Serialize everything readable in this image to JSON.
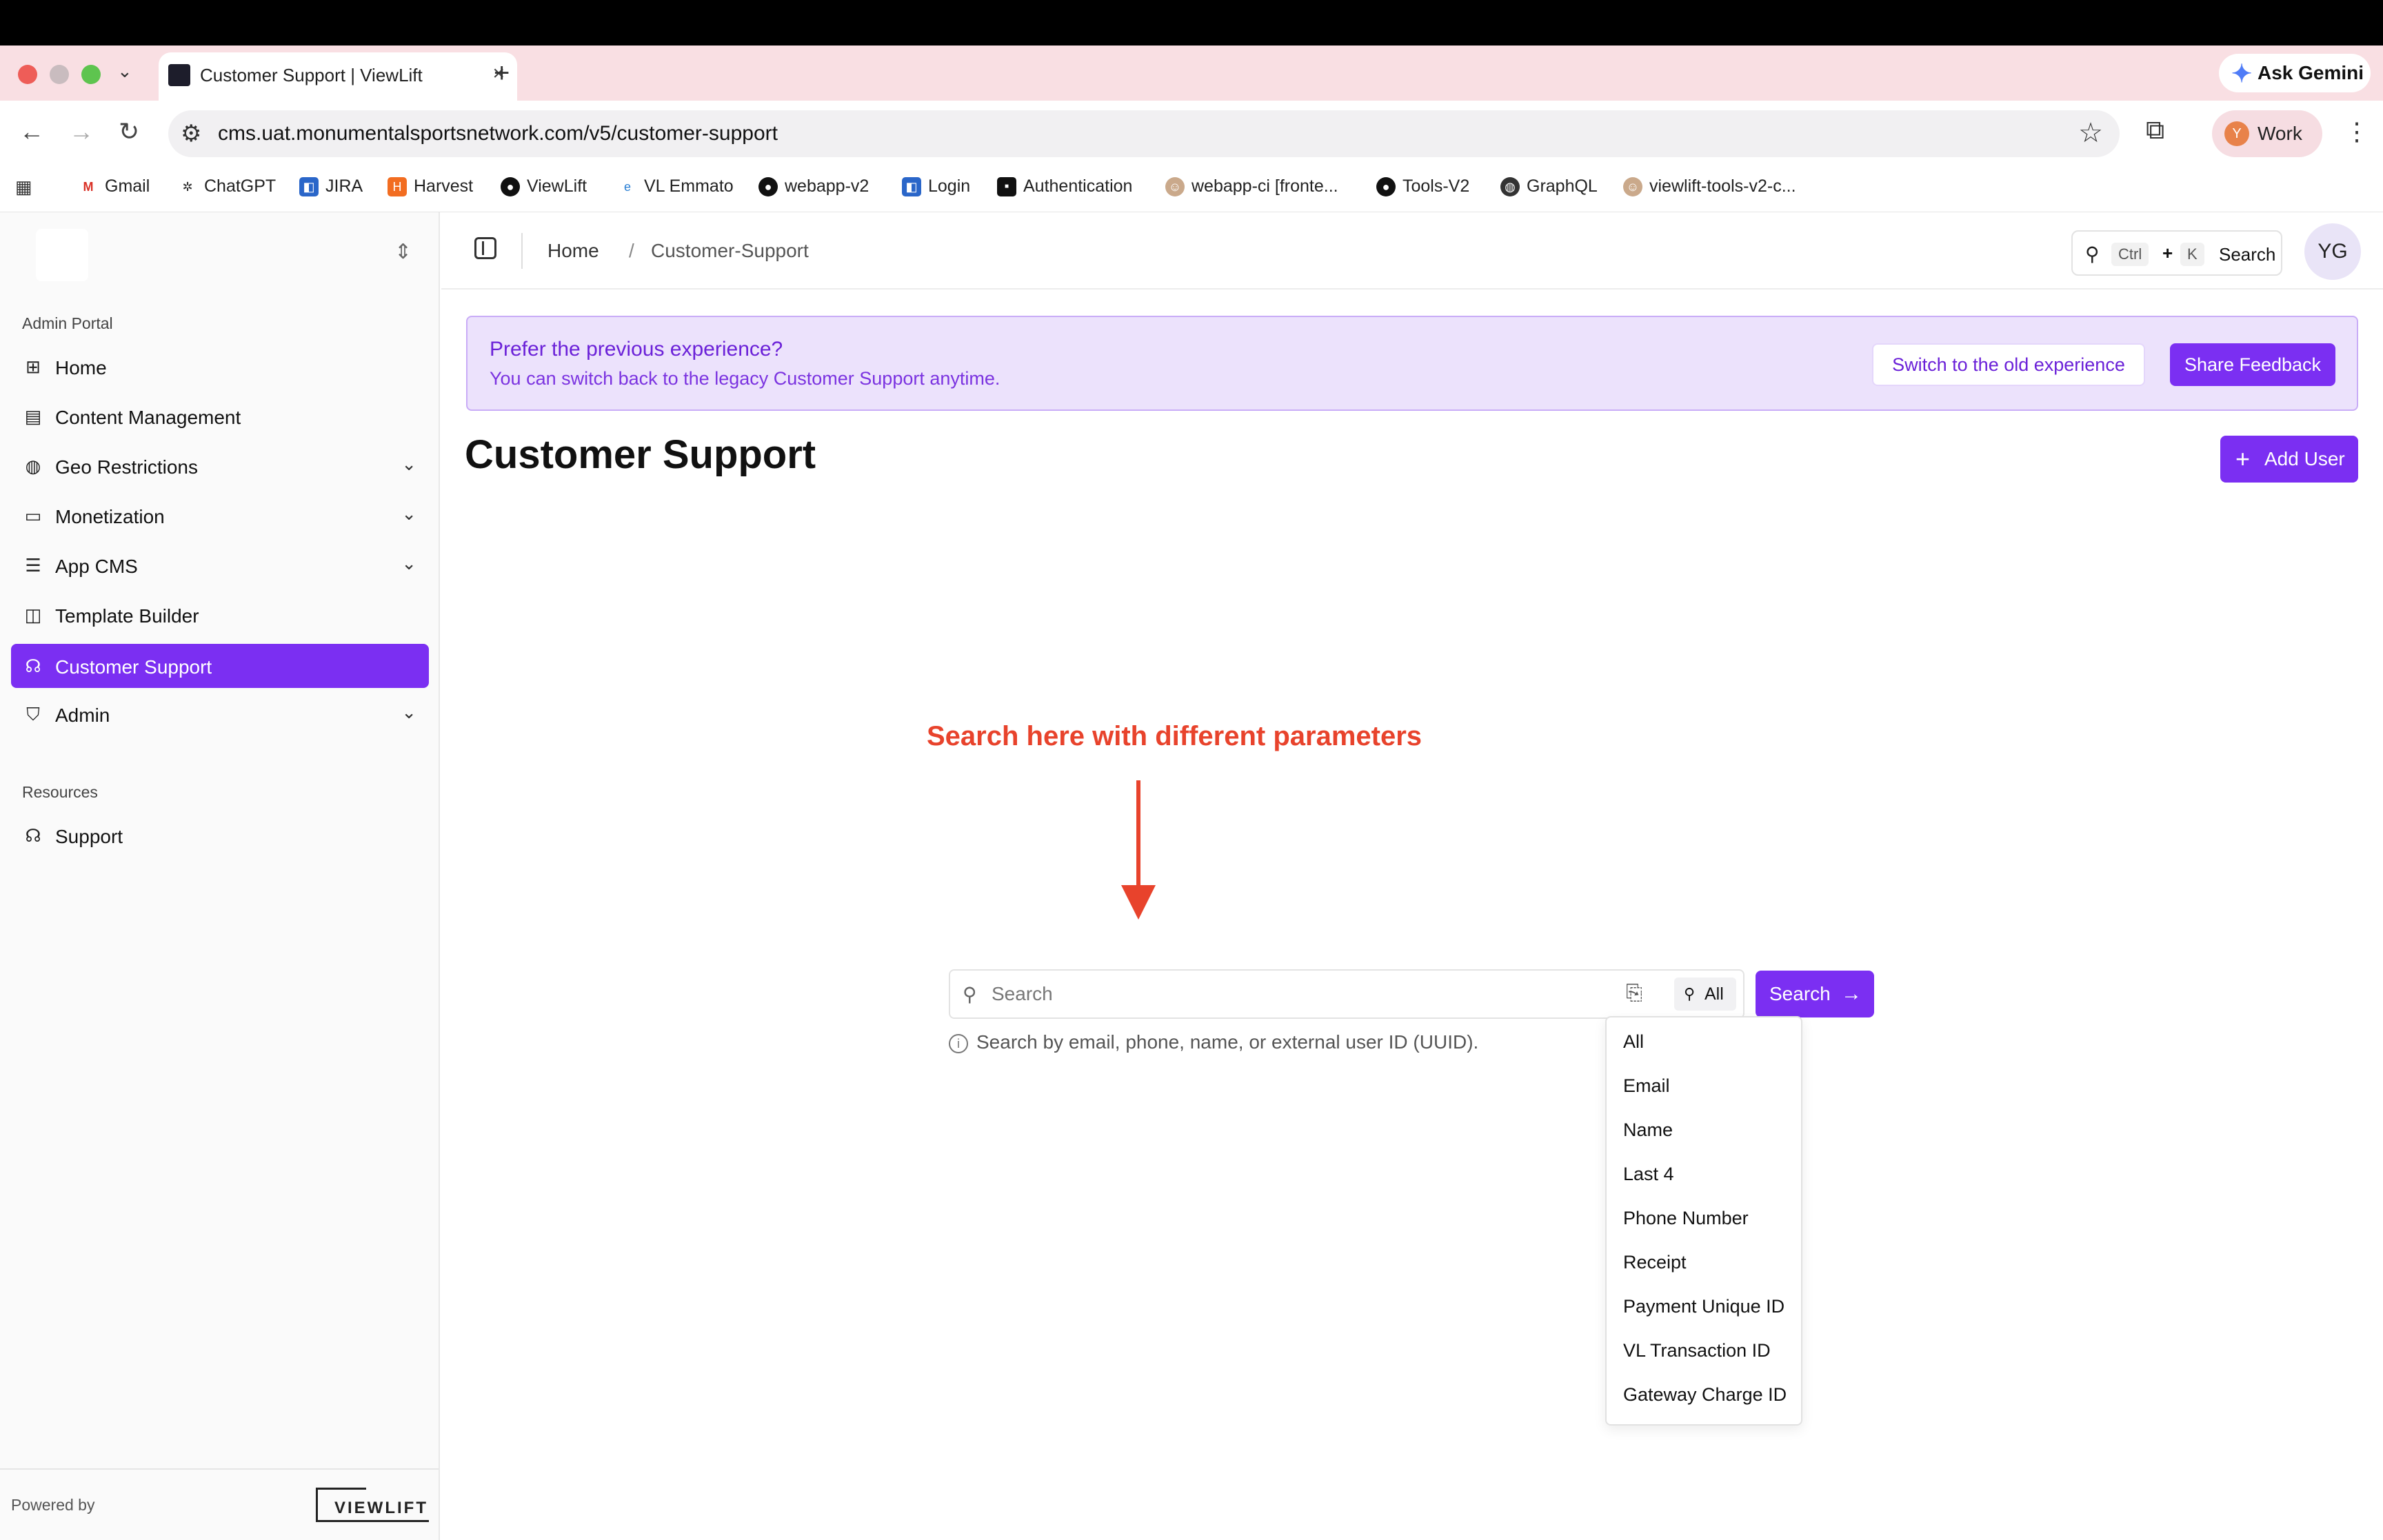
{
  "browser": {
    "tab_title": "Customer Support | ViewLift",
    "gemini_label": "Ask Gemini",
    "url": "cms.uat.monumentalsportsnetwork.com/v5/customer-support",
    "profile_initial": "Y",
    "profile_label": "Work",
    "bookmarks": [
      {
        "label": "Gmail"
      },
      {
        "label": "ChatGPT"
      },
      {
        "label": "JIRA"
      },
      {
        "label": "Harvest"
      },
      {
        "label": "ViewLift"
      },
      {
        "label": "VL Emmato"
      },
      {
        "label": "webapp-v2"
      },
      {
        "label": "Login"
      },
      {
        "label": "Authentication"
      },
      {
        "label": "webapp-ci [fronte..."
      },
      {
        "label": "Tools-V2"
      },
      {
        "label": "GraphQL"
      },
      {
        "label": "viewlift-tools-v2-c..."
      }
    ]
  },
  "sidebar": {
    "section_admin": "Admin Portal",
    "items": [
      {
        "label": "Home"
      },
      {
        "label": "Content Management"
      },
      {
        "label": "Geo Restrictions"
      },
      {
        "label": "Monetization"
      },
      {
        "label": "App CMS"
      },
      {
        "label": "Template Builder"
      },
      {
        "label": "Customer Support"
      },
      {
        "label": "Admin"
      }
    ],
    "section_resources": "Resources",
    "resources": [
      {
        "label": "Support"
      }
    ],
    "powered_by": "Powered by",
    "brand": "VIEWLIFT"
  },
  "header": {
    "breadcrumb_home": "Home",
    "breadcrumb_sep": "/",
    "breadcrumb_current": "Customer-Support",
    "search_key1": "Ctrl",
    "search_plus": "+",
    "search_key2": "K",
    "search_label": "Search",
    "avatar": "YG"
  },
  "notice": {
    "title": "Prefer the previous experience?",
    "subtitle": "You can switch back to the legacy Customer Support anytime.",
    "switch_button": "Switch to the old experience",
    "feedback_button": "Share Feedback"
  },
  "page": {
    "title": "Customer Support",
    "add_user": "Add User",
    "annotation": "Search here with different parameters"
  },
  "search": {
    "placeholder": "Search",
    "filter_label": "All",
    "button_label": "Search",
    "hint": "Search by email, phone, name, or external user ID (UUID).",
    "options": [
      {
        "label": "All"
      },
      {
        "label": "Email"
      },
      {
        "label": "Name"
      },
      {
        "label": "Last 4"
      },
      {
        "label": "Phone Number"
      },
      {
        "label": "Receipt"
      },
      {
        "label": "Payment Unique ID"
      },
      {
        "label": "VL Transaction ID"
      },
      {
        "label": "Gateway Charge ID"
      }
    ]
  },
  "colors": {
    "accent": "#7b2ff2",
    "annotation": "#e8432c"
  }
}
